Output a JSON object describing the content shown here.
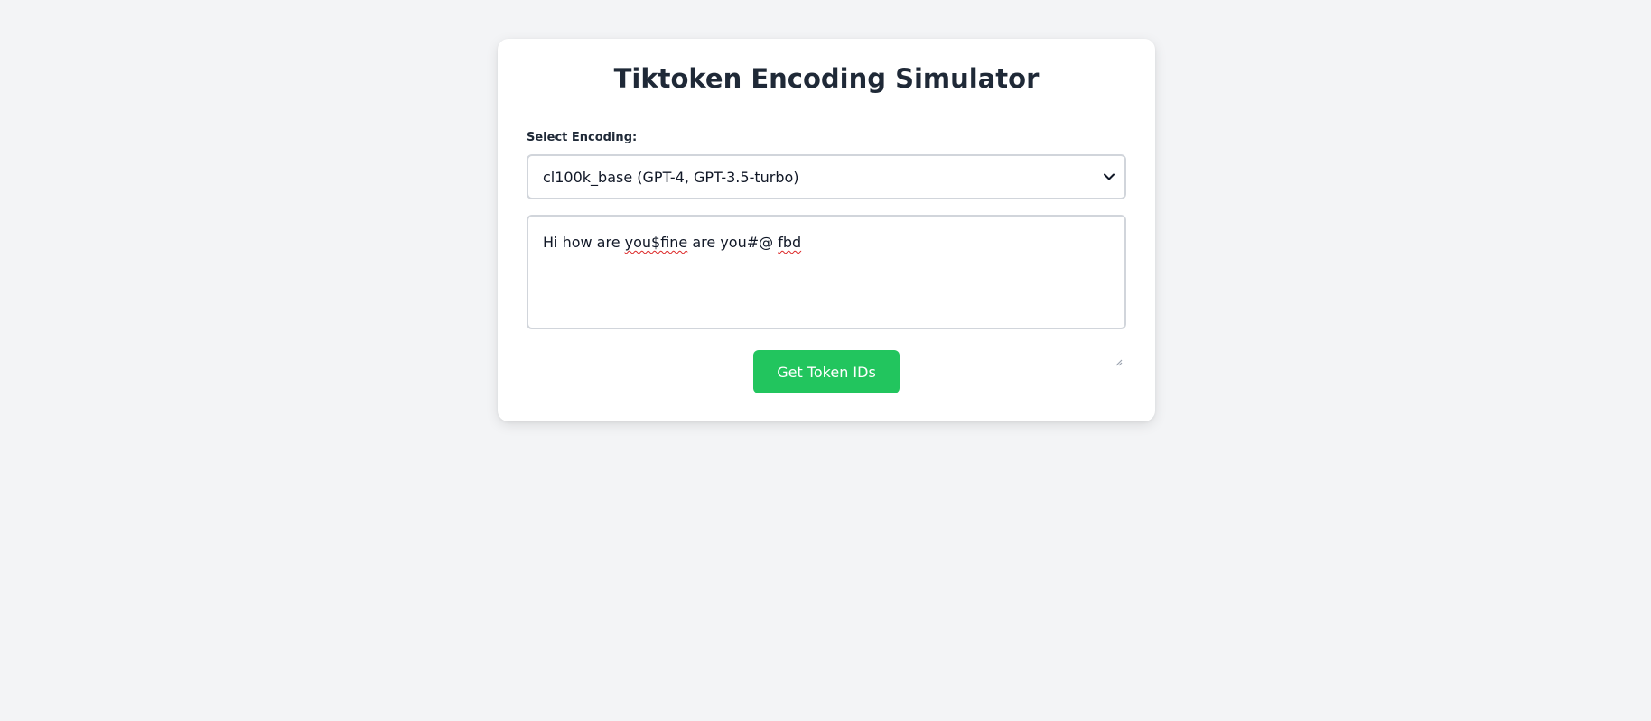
{
  "card": {
    "title": "Tiktoken Encoding Simulator",
    "encoding_label": "Select Encoding:",
    "encoding_selected": "cl100k_base (GPT-4, GPT-3.5-turbo)",
    "text_input": {
      "before": "Hi how are ",
      "misspelled_1": "you$fine",
      "middle": " are you#@ ",
      "misspelled_2": "fbd"
    },
    "submit_label": "Get Token IDs"
  },
  "icons": {
    "select_chevron": "chevron-down-icon",
    "textarea_resize": "resize-grip-icon"
  },
  "colors": {
    "background": "#f3f4f6",
    "card": "#ffffff",
    "title": "#1f2937",
    "button": "#22c55e",
    "border": "#d1d5db"
  }
}
